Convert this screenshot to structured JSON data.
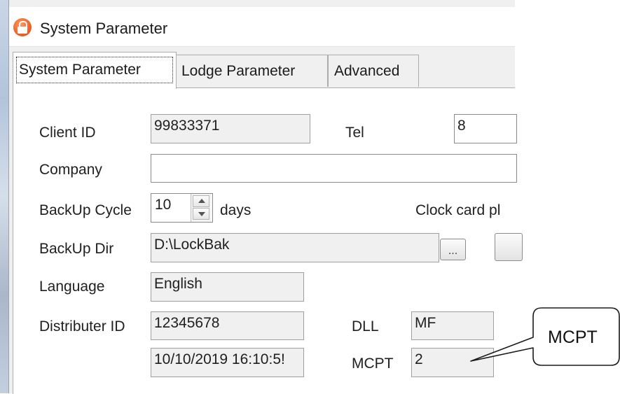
{
  "window": {
    "title": "System Parameter"
  },
  "tabs": [
    {
      "label": "System Parameter"
    },
    {
      "label": "Lodge Parameter"
    },
    {
      "label": "Advanced"
    }
  ],
  "form": {
    "client_id": {
      "label": "Client ID",
      "value": "99833371"
    },
    "tel": {
      "label": "Tel",
      "value": "8"
    },
    "company": {
      "label": "Company",
      "value": ""
    },
    "backup_cycle": {
      "label": "BackUp Cycle",
      "value": "10",
      "unit": "days"
    },
    "clock_card": {
      "label": "Clock card pl"
    },
    "backup_dir": {
      "label": "BackUp Dir",
      "value": "D:\\LockBak",
      "browse_label": "..."
    },
    "language": {
      "label": "Language",
      "value": "English"
    },
    "distributer_id": {
      "label": "Distributer ID",
      "value": "12345678"
    },
    "datetime": {
      "value": "10/10/2019 16:10:5!"
    },
    "dll": {
      "label": "DLL",
      "value": "MF"
    },
    "mcpt": {
      "label": "MCPT",
      "value": "2"
    }
  },
  "callout": {
    "text": "MCPT"
  }
}
